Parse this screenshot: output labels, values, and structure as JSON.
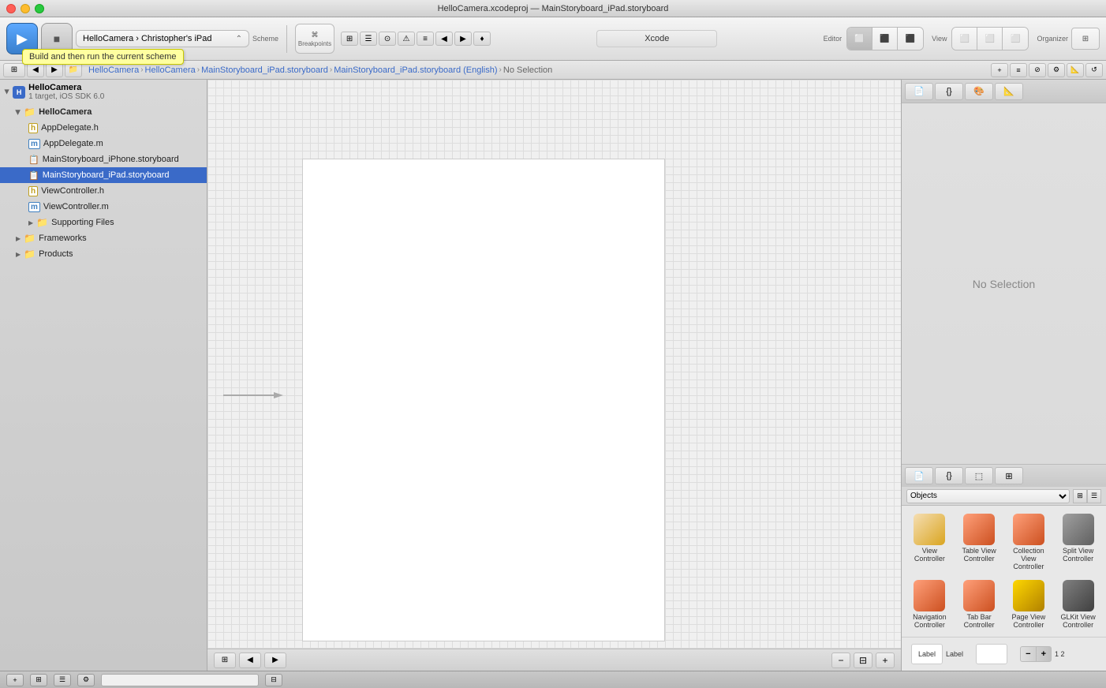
{
  "window": {
    "title": "HelloCamera.xcodeproj — MainStoryboard_iPad.storyboard"
  },
  "titlebar": {
    "title": "HelloCamera.xcodeproj — MainStoryboard_iPad.storyboard"
  },
  "toolbar": {
    "run_label": "▶",
    "stop_label": "■",
    "scheme_device": "HelloCamera › Christopher's iPad",
    "scheme_label": "Scheme",
    "breakpoints_label": "Breakpoints",
    "xcode_label": "Xcode",
    "editor_label": "Editor",
    "view_label": "View",
    "organizer_label": "Organizer",
    "tooltip": "Build and then run the current scheme"
  },
  "navbar": {
    "breadcrumbs": [
      "HelloCamera",
      "HelloCamera",
      "MainStoryboard_iPad.storyboard",
      "MainStoryboard_iPad.storyboard (English)",
      "No Selection"
    ]
  },
  "sidebar": {
    "project_name": "HelloCamera",
    "project_subtitle": "1 target, iOS SDK 6.0",
    "items": [
      {
        "label": "HelloCamera",
        "indent": 1,
        "type": "group",
        "expanded": true
      },
      {
        "label": "AppDelegate.h",
        "indent": 2,
        "type": "h-file"
      },
      {
        "label": "AppDelegate.m",
        "indent": 2,
        "type": "m-file"
      },
      {
        "label": "MainStoryboard_iPhone.storyboard",
        "indent": 2,
        "type": "storyboard"
      },
      {
        "label": "MainStoryboard_iPad.storyboard",
        "indent": 2,
        "type": "storyboard",
        "selected": true
      },
      {
        "label": "ViewController.h",
        "indent": 2,
        "type": "h-file"
      },
      {
        "label": "ViewController.m",
        "indent": 2,
        "type": "m-file"
      },
      {
        "label": "Supporting Files",
        "indent": 2,
        "type": "folder"
      },
      {
        "label": "Frameworks",
        "indent": 1,
        "type": "folder"
      },
      {
        "label": "Products",
        "indent": 1,
        "type": "folder"
      }
    ]
  },
  "canvas": {
    "no_selection_text": "No Selection"
  },
  "inspector": {
    "tabs": [
      "📄",
      "{}",
      "🎨",
      "📐"
    ],
    "no_selection": "No Selection"
  },
  "library": {
    "filter_options": [
      "Objects"
    ],
    "items": [
      {
        "label": "View Controller"
      },
      {
        "label": "Table View Controller"
      },
      {
        "label": "Collection View Controller"
      },
      {
        "label": "Navigation Controller"
      },
      {
        "label": "Tab Bar Controller"
      },
      {
        "label": "Page View Controller"
      },
      {
        "label": "GLKit View Controller"
      },
      {
        "label": "Split View Controller"
      }
    ],
    "bottom_items": [
      {
        "label": "Label",
        "type": "label"
      },
      {
        "label": "",
        "type": "textfield"
      },
      {
        "label": "1 2",
        "type": "stepper"
      }
    ]
  },
  "statusbar": {
    "text": ""
  }
}
